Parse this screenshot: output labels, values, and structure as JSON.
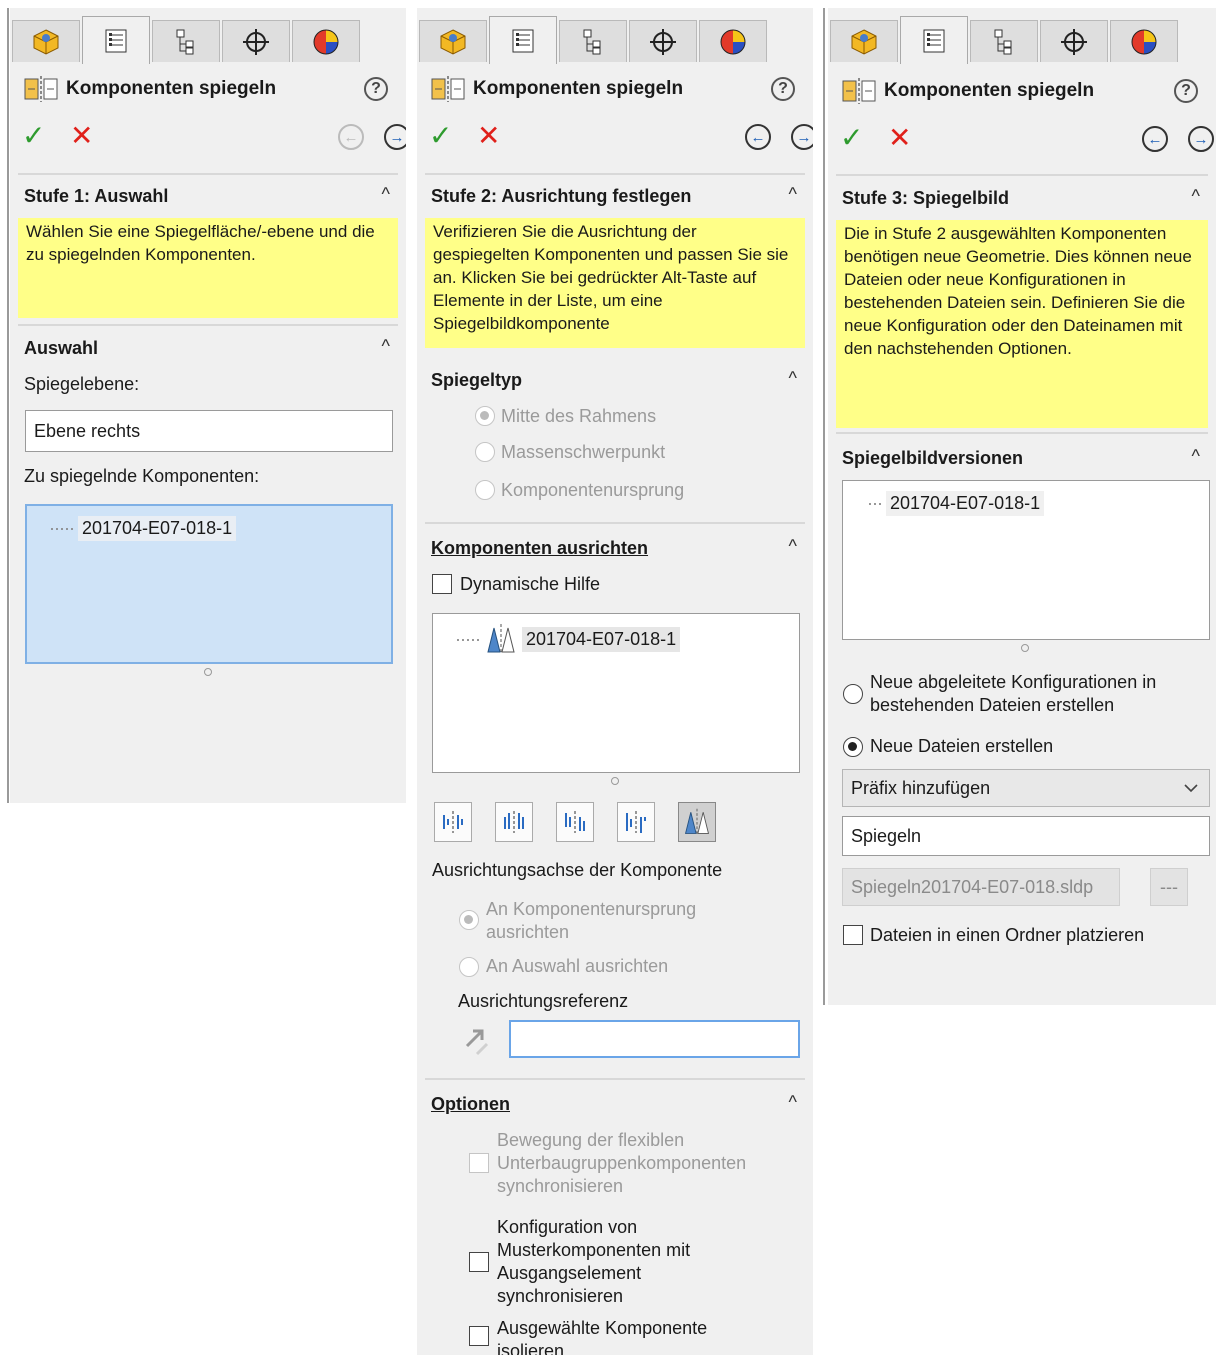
{
  "tab_icons": [
    "feature-manager-icon",
    "property-manager-icon",
    "configuration-manager-icon",
    "dim-xpert-icon",
    "display-manager-icon"
  ],
  "common": {
    "title": "Komponenten spiegeln",
    "help": "?",
    "ok": "✓",
    "cancel": "✕",
    "back": "←",
    "next": "→",
    "caret": "^"
  },
  "panel1": {
    "section_title": "Stufe 1: Auswahl",
    "message": "Wählen Sie eine Spiegelfläche/-ebene und die zu spiegelnden Komponenten.",
    "auswahl": {
      "title": "Auswahl",
      "mirror_plane_label": "Spiegelebene:",
      "mirror_plane_value": "Ebene rechts",
      "components_label": "Zu spiegelnde Komponenten:",
      "components": [
        "201704-E07-018-1"
      ]
    }
  },
  "panel2": {
    "section_title": "Stufe 2: Ausrichtung festlegen",
    "message": "Verifizieren Sie die Ausrichtung der gespiegelten Komponenten und passen Sie sie an. Klicken Sie bei gedrückter Alt-Taste auf Elemente in der Liste, um eine Spiegelbildkomponente",
    "mirror_type": {
      "title": "Spiegeltyp",
      "options": [
        "Mitte des Rahmens",
        "Massenschwerpunkt",
        "Komponentenursprung"
      ],
      "selected": "Mitte des Rahmens"
    },
    "align": {
      "title": "Komponenten ausrichten",
      "dynamic_help": "Dynamische Hilfe",
      "components": [
        "201704-E07-018-1"
      ],
      "axis_label": "Ausrichtungsachse der Komponente",
      "axis_options": [
        "An Komponentenursprung ausrichten",
        "An Auswahl ausrichten"
      ],
      "reference_label": "Ausrichtungsreferenz",
      "reference_value": ""
    },
    "options": {
      "title": "Optionen",
      "items": [
        "Bewegung der flexiblen Unterbaugruppenkomponenten synchronisieren",
        "Konfiguration von Musterkomponenten mit Ausgangselement synchronisieren",
        "Ausgewählte Komponente isolieren"
      ]
    }
  },
  "panel3": {
    "section_title": "Stufe 3: Spiegelbild",
    "message": "Die in Stufe 2 ausgewählten Komponenten benötigen neue Geometrie. Dies können neue Dateien oder neue Konfigurationen in bestehenden Dateien sein. Definieren Sie die neue Konfiguration oder den Dateinamen mit den nachstehenden Optionen.",
    "versions": {
      "title": "Spiegelbildversionen",
      "components": [
        "201704-E07-018-1"
      ],
      "radio_new_config": "Neue abgeleitete Konfigurationen in bestehenden Dateien erstellen",
      "radio_new_files": "Neue Dateien erstellen",
      "selected": "Neue Dateien erstellen",
      "dropdown_value": "Präfix hinzufügen",
      "prefix_value": "Spiegeln",
      "preview_filename": "Spiegeln201704-E07-018.sldp",
      "browse": "---",
      "folder_check": "Dateien in einen Ordner platzieren"
    }
  }
}
